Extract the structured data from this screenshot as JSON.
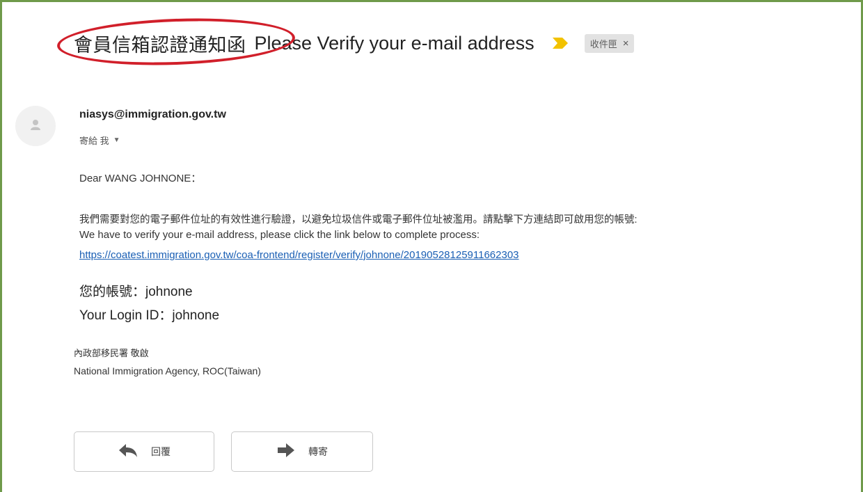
{
  "subject": {
    "zh": "會員信箱認證通知函",
    "en": "Please Verify your e-mail address",
    "label_chip": "收件匣",
    "label_close": "×",
    "important_icon": "important-arrow-icon"
  },
  "sender": {
    "email": "niasys@immigration.gov.tw",
    "to_label": "寄給 我",
    "details_caret": "▼",
    "avatar_icon": "person-icon"
  },
  "body": {
    "greeting": "Dear WANG JOHNONE：",
    "zh_instruction": "我們需要對您的電子郵件位址的有效性進行驗證，以避免垃圾信件或電子郵件位址被濫用。請點擊下方連結即可啟用您的帳號:",
    "en_instruction": "We have to verify your e-mail address, please click the link below to complete process:",
    "verify_link": "https://coatest.immigration.gov.tw/coa-frontend/register/verify/johnone/20190528125911662303",
    "account_line": "您的帳號：johnone",
    "login_line": "Your Login ID：johnone",
    "signature_zh": "內政部移民署 敬啟",
    "signature_en": "National Immigration Agency, ROC(Taiwan)"
  },
  "actions": {
    "reply_label": "回覆",
    "forward_label": "轉寄"
  },
  "colors": {
    "frame": "#6f9a4a",
    "highlight": "#d11f2a",
    "important": "#f2c200",
    "link": "#1a5fb4"
  }
}
